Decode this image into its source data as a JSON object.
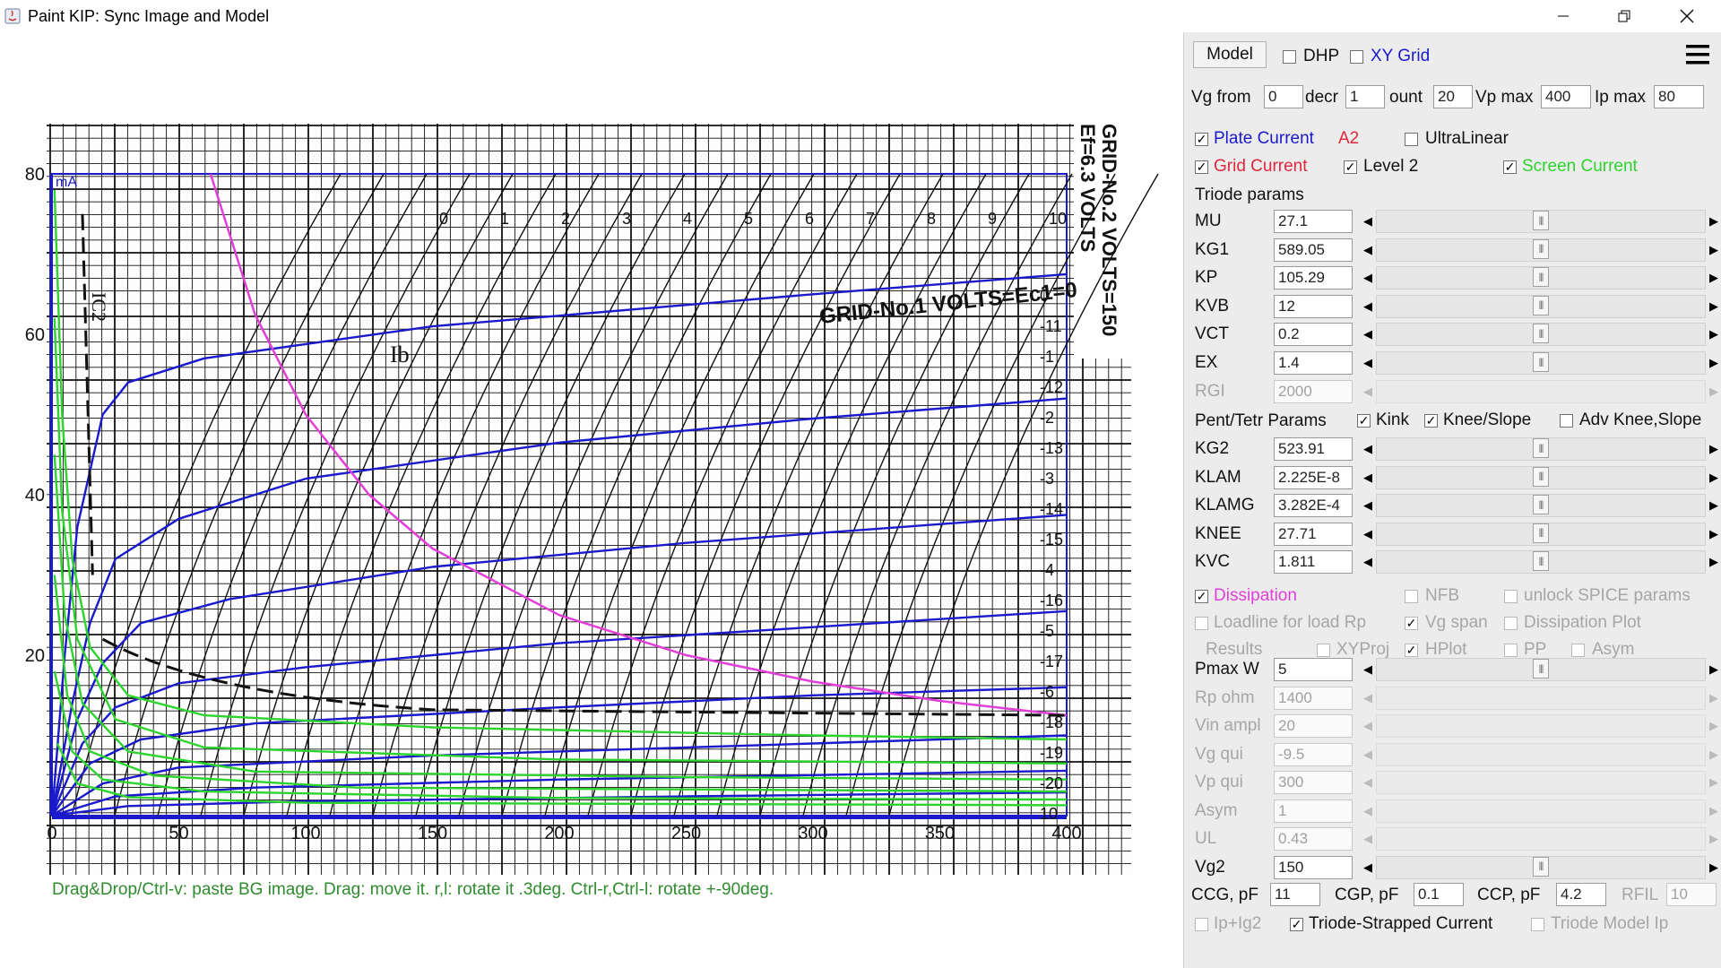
{
  "window": {
    "title": "Paint KIP: Sync Image and Model",
    "minimize": "—",
    "restore": "❐",
    "close": "✕"
  },
  "hint": "Drag&Drop/Ctrl-v: paste BG image. Drag: move it. r,l: rotate it .3deg. Ctrl-r,Ctrl-l: rotate +-90deg.",
  "chart_data": {
    "type": "line",
    "xlim": [
      0,
      400
    ],
    "ylim": [
      0,
      80
    ],
    "x_ticks": [
      "0",
      "50",
      "100",
      "150",
      "200",
      "250",
      "300",
      "350",
      "400"
    ],
    "y_ticks": [
      "20",
      "40",
      "60",
      "80"
    ],
    "unit_label": "mA",
    "image_labels": {
      "side_left": "E",
      "side_1": "f=6.3 VOLTS",
      "side_2": "GRID-No.2 VOLTS=150",
      "grid_label": "GRID-No.1 VOLTS=Ec1=0",
      "ib": "Ib",
      "ic2": "IC2",
      "top_ticks": [
        "0",
        "1",
        "2",
        "3",
        "4",
        "5",
        "6",
        "7",
        "8",
        "9",
        "10"
      ],
      "right_ticks": [
        "0",
        "-11",
        "-1",
        "-12",
        "-2",
        "-13",
        "-3",
        "-14",
        "-15",
        "-4",
        "-16",
        "-5",
        "-17",
        "-6",
        "-18",
        "-19",
        "-20",
        "10"
      ]
    },
    "series": [
      {
        "name": "Plate Current",
        "color": "#1a1acc",
        "curves": [
          {
            "vg": "0",
            "points": [
              [
                0,
                0
              ],
              [
                5,
                20
              ],
              [
                10,
                36
              ],
              [
                20,
                50
              ],
              [
                30,
                54
              ],
              [
                60,
                57
              ],
              [
                150,
                61
              ],
              [
                300,
                65
              ],
              [
                400,
                67.5
              ]
            ]
          },
          {
            "vg": "-1",
            "points": [
              [
                0,
                0
              ],
              [
                8,
                14
              ],
              [
                15,
                24
              ],
              [
                25,
                32
              ],
              [
                50,
                37
              ],
              [
                100,
                42
              ],
              [
                200,
                46.5
              ],
              [
                300,
                49.5
              ],
              [
                400,
                52
              ]
            ]
          },
          {
            "vg": "-2",
            "points": [
              [
                0,
                0
              ],
              [
                10,
                12
              ],
              [
                20,
                19
              ],
              [
                35,
                24
              ],
              [
                70,
                27
              ],
              [
                150,
                31
              ],
              [
                250,
                34
              ],
              [
                400,
                37.5
              ]
            ]
          },
          {
            "vg": "-3",
            "points": [
              [
                0,
                0
              ],
              [
                12,
                9
              ],
              [
                25,
                13.5
              ],
              [
                50,
                16.5
              ],
              [
                100,
                18.5
              ],
              [
                200,
                21.5
              ],
              [
                300,
                23.5
              ],
              [
                400,
                25.5
              ]
            ]
          },
          {
            "vg": "-4",
            "points": [
              [
                0,
                0
              ],
              [
                15,
                6.5
              ],
              [
                35,
                9.5
              ],
              [
                80,
                11.5
              ],
              [
                200,
                13.5
              ],
              [
                300,
                15
              ],
              [
                400,
                16
              ]
            ]
          },
          {
            "vg": "-5",
            "points": [
              [
                0,
                0
              ],
              [
                20,
                4
              ],
              [
                50,
                6
              ],
              [
                150,
                7.5
              ],
              [
                300,
                9
              ],
              [
                400,
                10
              ]
            ]
          },
          {
            "vg": "-6",
            "points": [
              [
                0,
                0
              ],
              [
                25,
                2.4
              ],
              [
                80,
                3.5
              ],
              [
                200,
                4.5
              ],
              [
                400,
                5.6
              ]
            ]
          },
          {
            "vg": "-7",
            "points": [
              [
                0,
                0
              ],
              [
                30,
                1.2
              ],
              [
                100,
                1.8
              ],
              [
                250,
                2.4
              ],
              [
                400,
                2.9
              ]
            ]
          }
        ]
      },
      {
        "name": "Screen Current",
        "color": "#2dd42d",
        "curves": [
          {
            "vg": "0",
            "points": [
              [
                1,
                78
              ],
              [
                4,
                50
              ],
              [
                8,
                32
              ],
              [
                15,
                21
              ],
              [
                30,
                15
              ],
              [
                60,
                12.5
              ],
              [
                150,
                11
              ],
              [
                300,
                10
              ],
              [
                400,
                9.5
              ]
            ]
          },
          {
            "vg": "-1",
            "points": [
              [
                1,
                62
              ],
              [
                4,
                38
              ],
              [
                10,
                22
              ],
              [
                25,
                12
              ],
              [
                60,
                8.5
              ],
              [
                200,
                7
              ],
              [
                400,
                6.5
              ]
            ]
          },
          {
            "vg": "-2",
            "points": [
              [
                1,
                45
              ],
              [
                5,
                25
              ],
              [
                12,
                14
              ],
              [
                30,
                8
              ],
              [
                80,
                5.5
              ],
              [
                250,
                4.8
              ],
              [
                400,
                4.5
              ]
            ]
          },
          {
            "vg": "-3",
            "points": [
              [
                1,
                30
              ],
              [
                6,
                15
              ],
              [
                15,
                8
              ],
              [
                40,
                5
              ],
              [
                120,
                3.5
              ],
              [
                400,
                3
              ]
            ]
          },
          {
            "vg": "-4",
            "points": [
              [
                1,
                18
              ],
              [
                8,
                8
              ],
              [
                20,
                4.5
              ],
              [
                60,
                3
              ],
              [
                200,
                2.2
              ],
              [
                400,
                2
              ]
            ]
          },
          {
            "vg": "-5",
            "points": [
              [
                2,
                9
              ],
              [
                10,
                4
              ],
              [
                30,
                2.3
              ],
              [
                100,
                1.6
              ],
              [
                400,
                1.3
              ]
            ]
          }
        ]
      },
      {
        "name": "Dissipation",
        "color": "#e23ed8",
        "curves": [
          {
            "vg": "Pmax 5W",
            "points": [
              [
                62.5,
                80
              ],
              [
                80,
                62.5
              ],
              [
                100,
                50
              ],
              [
                125,
                40
              ],
              [
                150,
                33.3
              ],
              [
                200,
                25
              ],
              [
                250,
                20
              ],
              [
                300,
                16.7
              ],
              [
                350,
                14.3
              ],
              [
                400,
                12.5
              ]
            ]
          }
        ]
      }
    ]
  },
  "panel": {
    "model_button": "Model",
    "dhp": {
      "label": "DHP",
      "checked": false
    },
    "xy_grid": {
      "label": "XY Grid",
      "checked": false
    },
    "vg_from": {
      "label": "Vg from",
      "value": "0"
    },
    "decr": {
      "label": "decr",
      "value": "1"
    },
    "count": {
      "label": "ount",
      "value": "20"
    },
    "vp_max": {
      "label": "Vp max",
      "value": "400"
    },
    "ip_max": {
      "label": "Ip max",
      "value": "80"
    },
    "plate_current": {
      "label": "Plate Current",
      "checked": true
    },
    "a2": "A2",
    "ultralinear": {
      "label": "UltraLinear",
      "checked": false
    },
    "grid_current": {
      "label": "Grid Current",
      "checked": true
    },
    "level2": {
      "label": "Level 2",
      "checked": true
    },
    "screen_current": {
      "label": "Screen Current",
      "checked": true
    },
    "triode_params_header": "Triode params",
    "triode_params": [
      {
        "name": "MU",
        "value": "27.1",
        "pos": 0.5,
        "disabled": false
      },
      {
        "name": "KG1",
        "value": "589.05",
        "pos": 0.5,
        "disabled": false
      },
      {
        "name": "KP",
        "value": "105.29",
        "pos": 0.5,
        "disabled": false
      },
      {
        "name": "KVB",
        "value": "12",
        "pos": 0.5,
        "disabled": false
      },
      {
        "name": "VCT",
        "value": "0.2",
        "pos": 0.5,
        "disabled": false
      },
      {
        "name": "EX",
        "value": "1.4",
        "pos": 0.5,
        "disabled": false
      },
      {
        "name": "RGI",
        "value": "2000",
        "pos": null,
        "disabled": true
      }
    ],
    "pent_header": "Pent/Tetr Params",
    "kink": {
      "label": "Kink",
      "checked": true
    },
    "knee_slope": {
      "label": "Knee/Slope",
      "checked": true
    },
    "adv_knee": {
      "label": "Adv Knee,Slope",
      "checked": false
    },
    "pent_params": [
      {
        "name": "KG2",
        "value": "523.91",
        "pos": 0.5,
        "disabled": false
      },
      {
        "name": "KLAM",
        "value": "2.225E-8",
        "pos": 0.5,
        "disabled": false
      },
      {
        "name": "KLAMG",
        "value": "3.282E-4",
        "pos": 0.5,
        "disabled": false
      },
      {
        "name": "KNEE",
        "value": "27.71",
        "pos": 0.5,
        "disabled": false
      },
      {
        "name": "KVC",
        "value": "1.811",
        "pos": 0.5,
        "disabled": false
      }
    ],
    "dissipation": {
      "label": "Dissipation",
      "checked": true
    },
    "nfb": {
      "label": "NFB",
      "checked": false
    },
    "unlock_spice": {
      "label": "unlock SPICE params",
      "checked": false
    },
    "loadline": {
      "label": "Loadline for load Rp",
      "checked": false
    },
    "vg_span": {
      "label": "Vg span",
      "checked": true
    },
    "dissipation_plot": {
      "label": "Dissipation Plot",
      "checked": false
    },
    "results": "Results",
    "xyproj": {
      "label": "XYProj",
      "checked": false
    },
    "hplot": {
      "label": "HPlot",
      "checked": true
    },
    "pp": {
      "label": "PP",
      "checked": false
    },
    "asym_cb": {
      "label": "Asym",
      "checked": false
    },
    "lower_params": [
      {
        "name": "Pmax W",
        "value": "5",
        "pos": 0.5,
        "disabled": false
      },
      {
        "name": "Rp ohm",
        "value": "1400",
        "pos": null,
        "disabled": true
      },
      {
        "name": "Vin ampl",
        "value": "20",
        "pos": null,
        "disabled": true
      },
      {
        "name": "Vg qui",
        "value": "-9.5",
        "pos": null,
        "disabled": true
      },
      {
        "name": "Vp qui",
        "value": "300",
        "pos": null,
        "disabled": true
      },
      {
        "name": "Asym",
        "value": "1",
        "pos": null,
        "disabled": true
      },
      {
        "name": "UL",
        "value": "0.43",
        "pos": null,
        "disabled": true
      },
      {
        "name": "Vg2",
        "value": "150",
        "pos": 0.5,
        "disabled": false
      }
    ],
    "ccg": {
      "label": "CCG, pF",
      "value": "11"
    },
    "cgp": {
      "label": "CGP, pF",
      "value": "0.1"
    },
    "ccp": {
      "label": "CCP, pF",
      "value": "4.2"
    },
    "rfil": {
      "label": "RFIL",
      "value": "10"
    },
    "ip_ig2": {
      "label": "Ip+Ig2",
      "checked": false
    },
    "triode_strapped": {
      "label": "Triode-Strapped Current",
      "checked": true
    },
    "triode_model_ip": {
      "label": "Triode Model Ip",
      "checked": false
    }
  },
  "colors": {
    "plate": "#1a1acc",
    "grid": "#e0263c",
    "screen": "#2dd42d",
    "dissipation": "#e23ed8",
    "hint": "#2e8b2e",
    "xygrid": "#1a1acc"
  }
}
